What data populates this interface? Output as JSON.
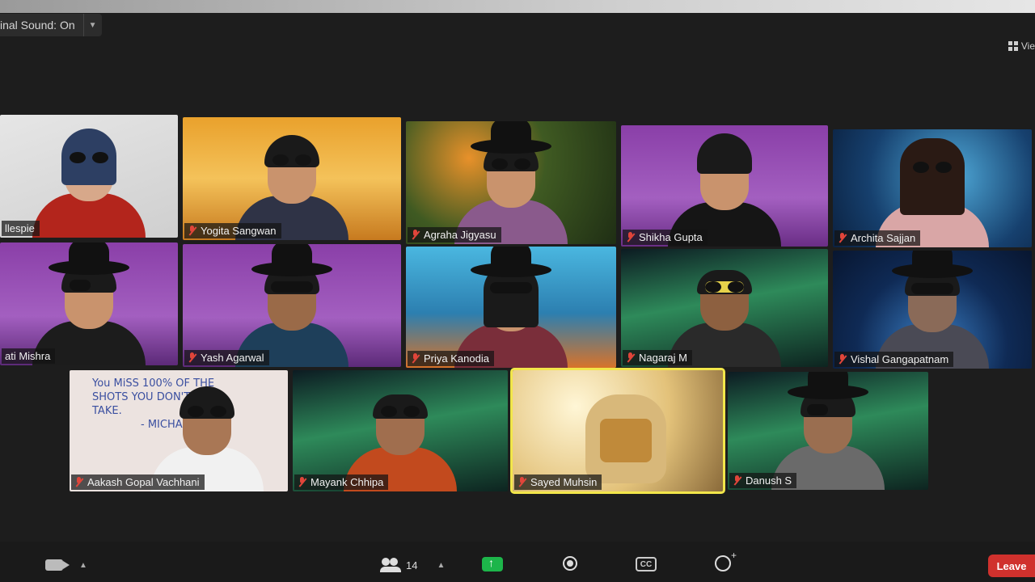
{
  "header": {
    "sound_label": "inal Sound: On",
    "view_label": "Vie"
  },
  "participants": [
    {
      "name": "llespie",
      "muted": false
    },
    {
      "name": "Yogita Sangwan",
      "muted": true
    },
    {
      "name": "Agraha Jigyasu",
      "muted": true
    },
    {
      "name": "Shikha Gupta",
      "muted": true
    },
    {
      "name": "Archita Sajjan",
      "muted": true
    },
    {
      "name": "ati Mishra",
      "muted": false
    },
    {
      "name": "Yash Agarwal",
      "muted": true
    },
    {
      "name": "Priya Kanodia",
      "muted": true
    },
    {
      "name": "Nagaraj M",
      "muted": true
    },
    {
      "name": "Vishal Gangapatnam",
      "muted": true
    },
    {
      "name": "Aakash Gopal Vachhani",
      "muted": true
    },
    {
      "name": "Mayank Chhipa",
      "muted": true
    },
    {
      "name": "Sayed Muhsin",
      "muted": true
    },
    {
      "name": "Danush S",
      "muted": true
    }
  ],
  "whiteboard": {
    "line1": "You MiSS 100% OF THE",
    "line2": "SHOTS YOU DON'T",
    "line3": "TAKE.",
    "line4": "- MICHA"
  },
  "toolbar": {
    "participants_count": "14",
    "leave_label": "Leave"
  },
  "colors": {
    "active_speaker": "#f2e64a",
    "leave": "#d0312d",
    "share": "#1db54a",
    "mic_muted": "#e0453a"
  }
}
